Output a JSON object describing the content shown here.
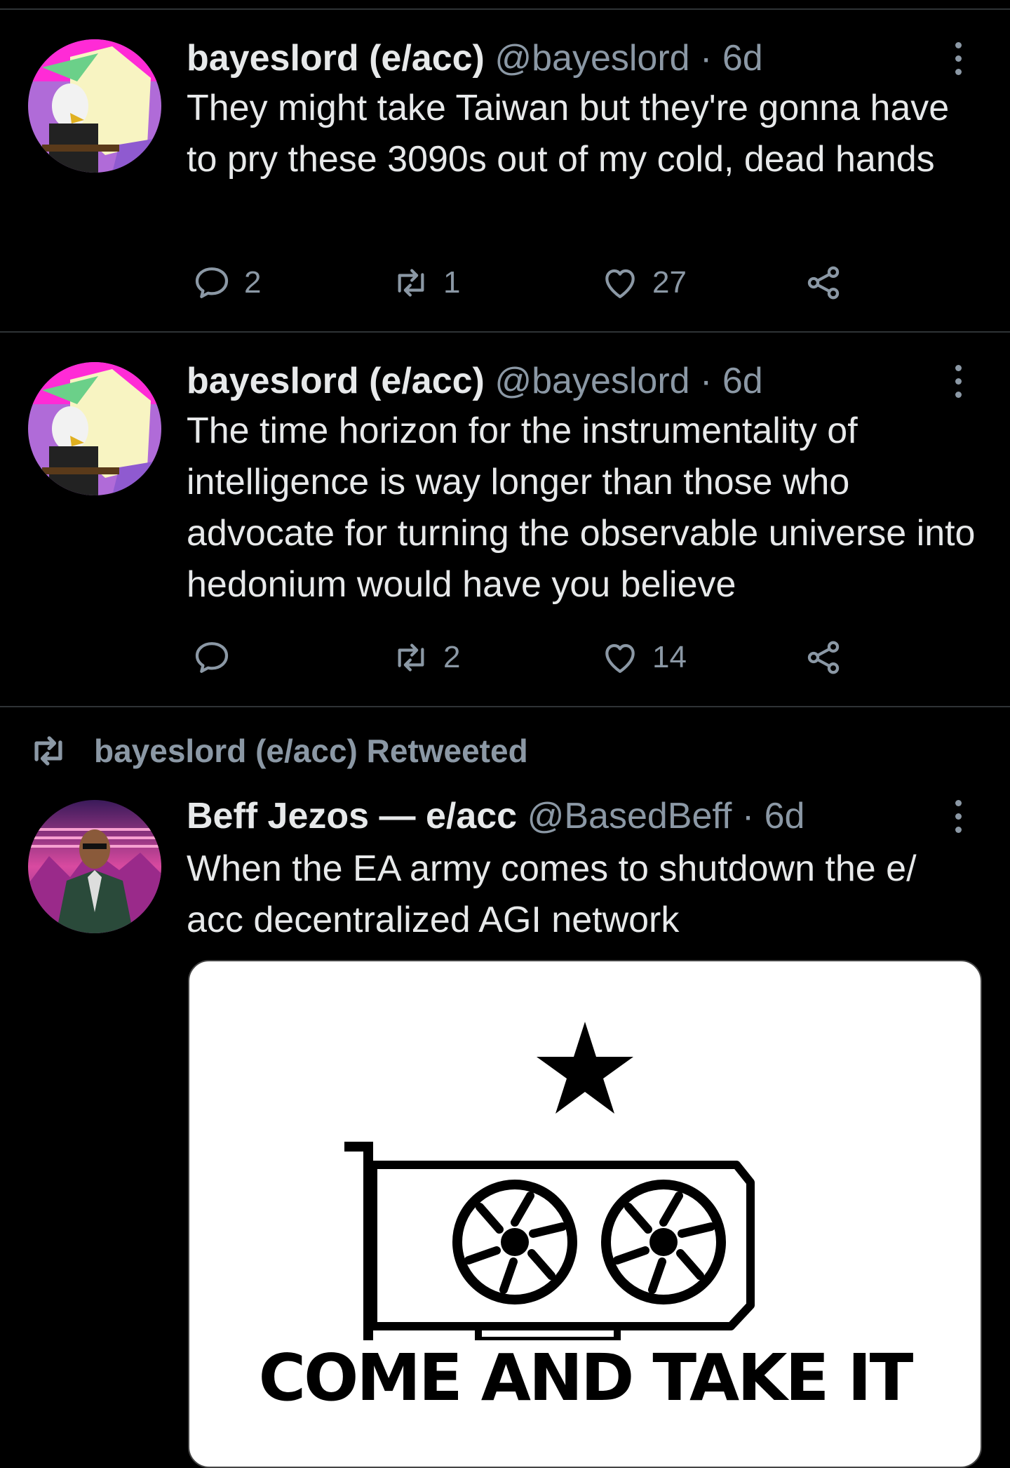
{
  "tweets": [
    {
      "name": "bayeslord (e/acc)",
      "handle": "@bayeslord",
      "separator": "·",
      "time": "6d",
      "text": "They might take Taiwan but they're gonna have to pry these 3090s out of my cold, dead hands",
      "replies": "2",
      "retweets": "1",
      "likes": "27"
    },
    {
      "name": "bayeslord (e/acc)",
      "handle": "@bayeslord",
      "separator": "·",
      "time": "6d",
      "text": "The time horizon for the instrumentality of intelligence is way longer than those who advocate for turning the observable universe into hedonium would have you believe",
      "replies": "",
      "retweets": "2",
      "likes": "14"
    },
    {
      "retweeted_by": "bayeslord (e/acc) Retweeted",
      "name": "Beff Jezos — e/acc",
      "handle": "@BasedBeff",
      "separator": "·",
      "time": "6d",
      "text": "When the EA army comes to shutdown the e/ acc decentralized AGI network",
      "image_caption": "COME AND TAKE IT"
    }
  ],
  "icons": {
    "reply": "reply-icon",
    "retweet": "retweet-icon",
    "like": "heart-icon",
    "share": "share-icon",
    "more": "more-options-icon"
  },
  "colors": {
    "background": "#000000",
    "text": "#e7e9ea",
    "muted": "#8b98a5",
    "divider": "#2f3336"
  }
}
